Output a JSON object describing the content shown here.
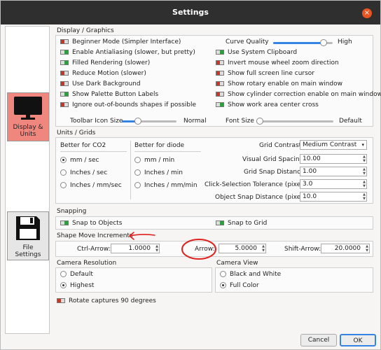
{
  "window": {
    "title": "Settings",
    "close": "×"
  },
  "sidebar": [
    {
      "label1": "Display &",
      "label2": "Units",
      "icon": "monitor-icon"
    },
    {
      "label1": "File",
      "label2": "Settings",
      "icon": "floppy-disk-icon"
    }
  ],
  "display": {
    "title": "Display / Graphics",
    "left": [
      {
        "label": "Beginner Mode (Simpler Interface)",
        "on": false
      },
      {
        "label": "Enable Antialiasing (slower, but pretty)",
        "on": true
      },
      {
        "label": "Filled Rendering (slower)",
        "on": true
      },
      {
        "label": "Reduce Motion (slower)",
        "on": false
      },
      {
        "label": "Use Dark Background",
        "on": false
      },
      {
        "label": "Show Palette Button Labels",
        "on": true
      },
      {
        "label": "Ignore out-of-bounds shapes if possible",
        "on": false
      }
    ],
    "curve_label": "Curve Quality",
    "curve_value": "High",
    "curve_fraction": 0.85,
    "right": [
      {
        "label": "Use System Clipboard",
        "on": true
      },
      {
        "label": "Invert mouse wheel zoom direction",
        "on": false
      },
      {
        "label": "Show full screen line cursor",
        "on": false
      },
      {
        "label": "Show rotary enable on main window",
        "on": false
      },
      {
        "label": "Show cylinder correction enable on main window",
        "on": false
      },
      {
        "label": "Show work area center cross",
        "on": true
      }
    ],
    "toolbar_label": "Toolbar Icon Size",
    "toolbar_value": "Normal",
    "toolbar_fraction": 0.3,
    "font_label": "Font Size",
    "font_value": "Default",
    "font_fraction": 0.0
  },
  "units": {
    "title": "Units / Grids",
    "co2_title": "Better for CO2",
    "co2": [
      {
        "label": "mm / sec",
        "sel": true
      },
      {
        "label": "Inches / sec",
        "sel": false
      },
      {
        "label": "Inches / mm/sec",
        "sel": false
      }
    ],
    "diode_title": "Better for diode",
    "diode": [
      {
        "label": "mm / min",
        "sel": false
      },
      {
        "label": "Inches / min",
        "sel": false
      },
      {
        "label": "Inches / mm/min",
        "sel": false
      }
    ],
    "grid_contrast_label": "Grid Contrast",
    "grid_contrast_value": "Medium Contrast",
    "visual_spacing_label": "Visual Grid Spacing",
    "visual_spacing_value": "10.00",
    "snap_distance_label": "Grid Snap Distance",
    "snap_distance_value": "1.00",
    "click_tol_label": "Click-Selection Tolerance (pixels)",
    "click_tol_value": "3.0",
    "obj_snap_label": "Object Snap Distance (pixels)",
    "obj_snap_value": "10.0"
  },
  "snapping": {
    "title": "Snapping",
    "objects_label": "Snap to Objects",
    "objects_on": true,
    "grid_label": "Snap to Grid",
    "grid_on": true
  },
  "move": {
    "title": "Shape Move Increments",
    "ctrl_label": "Ctrl-Arrow:",
    "ctrl_value": "1.0000",
    "arrow_label": "Arrow:",
    "arrow_value": "5.0000",
    "shift_label": "Shift-Arrow:",
    "shift_value": "20.0000"
  },
  "camera_res": {
    "title": "Camera Resolution",
    "opt1": "Default",
    "opt2": "Highest"
  },
  "camera_view": {
    "title": "Camera View",
    "opt1": "Black and White",
    "opt2": "Full Color"
  },
  "rotate": {
    "label": "Rotate captures 90 degrees",
    "on": false
  },
  "buttons": {
    "cancel": "Cancel",
    "ok": "OK"
  },
  "annotation_color": "#e0211e"
}
